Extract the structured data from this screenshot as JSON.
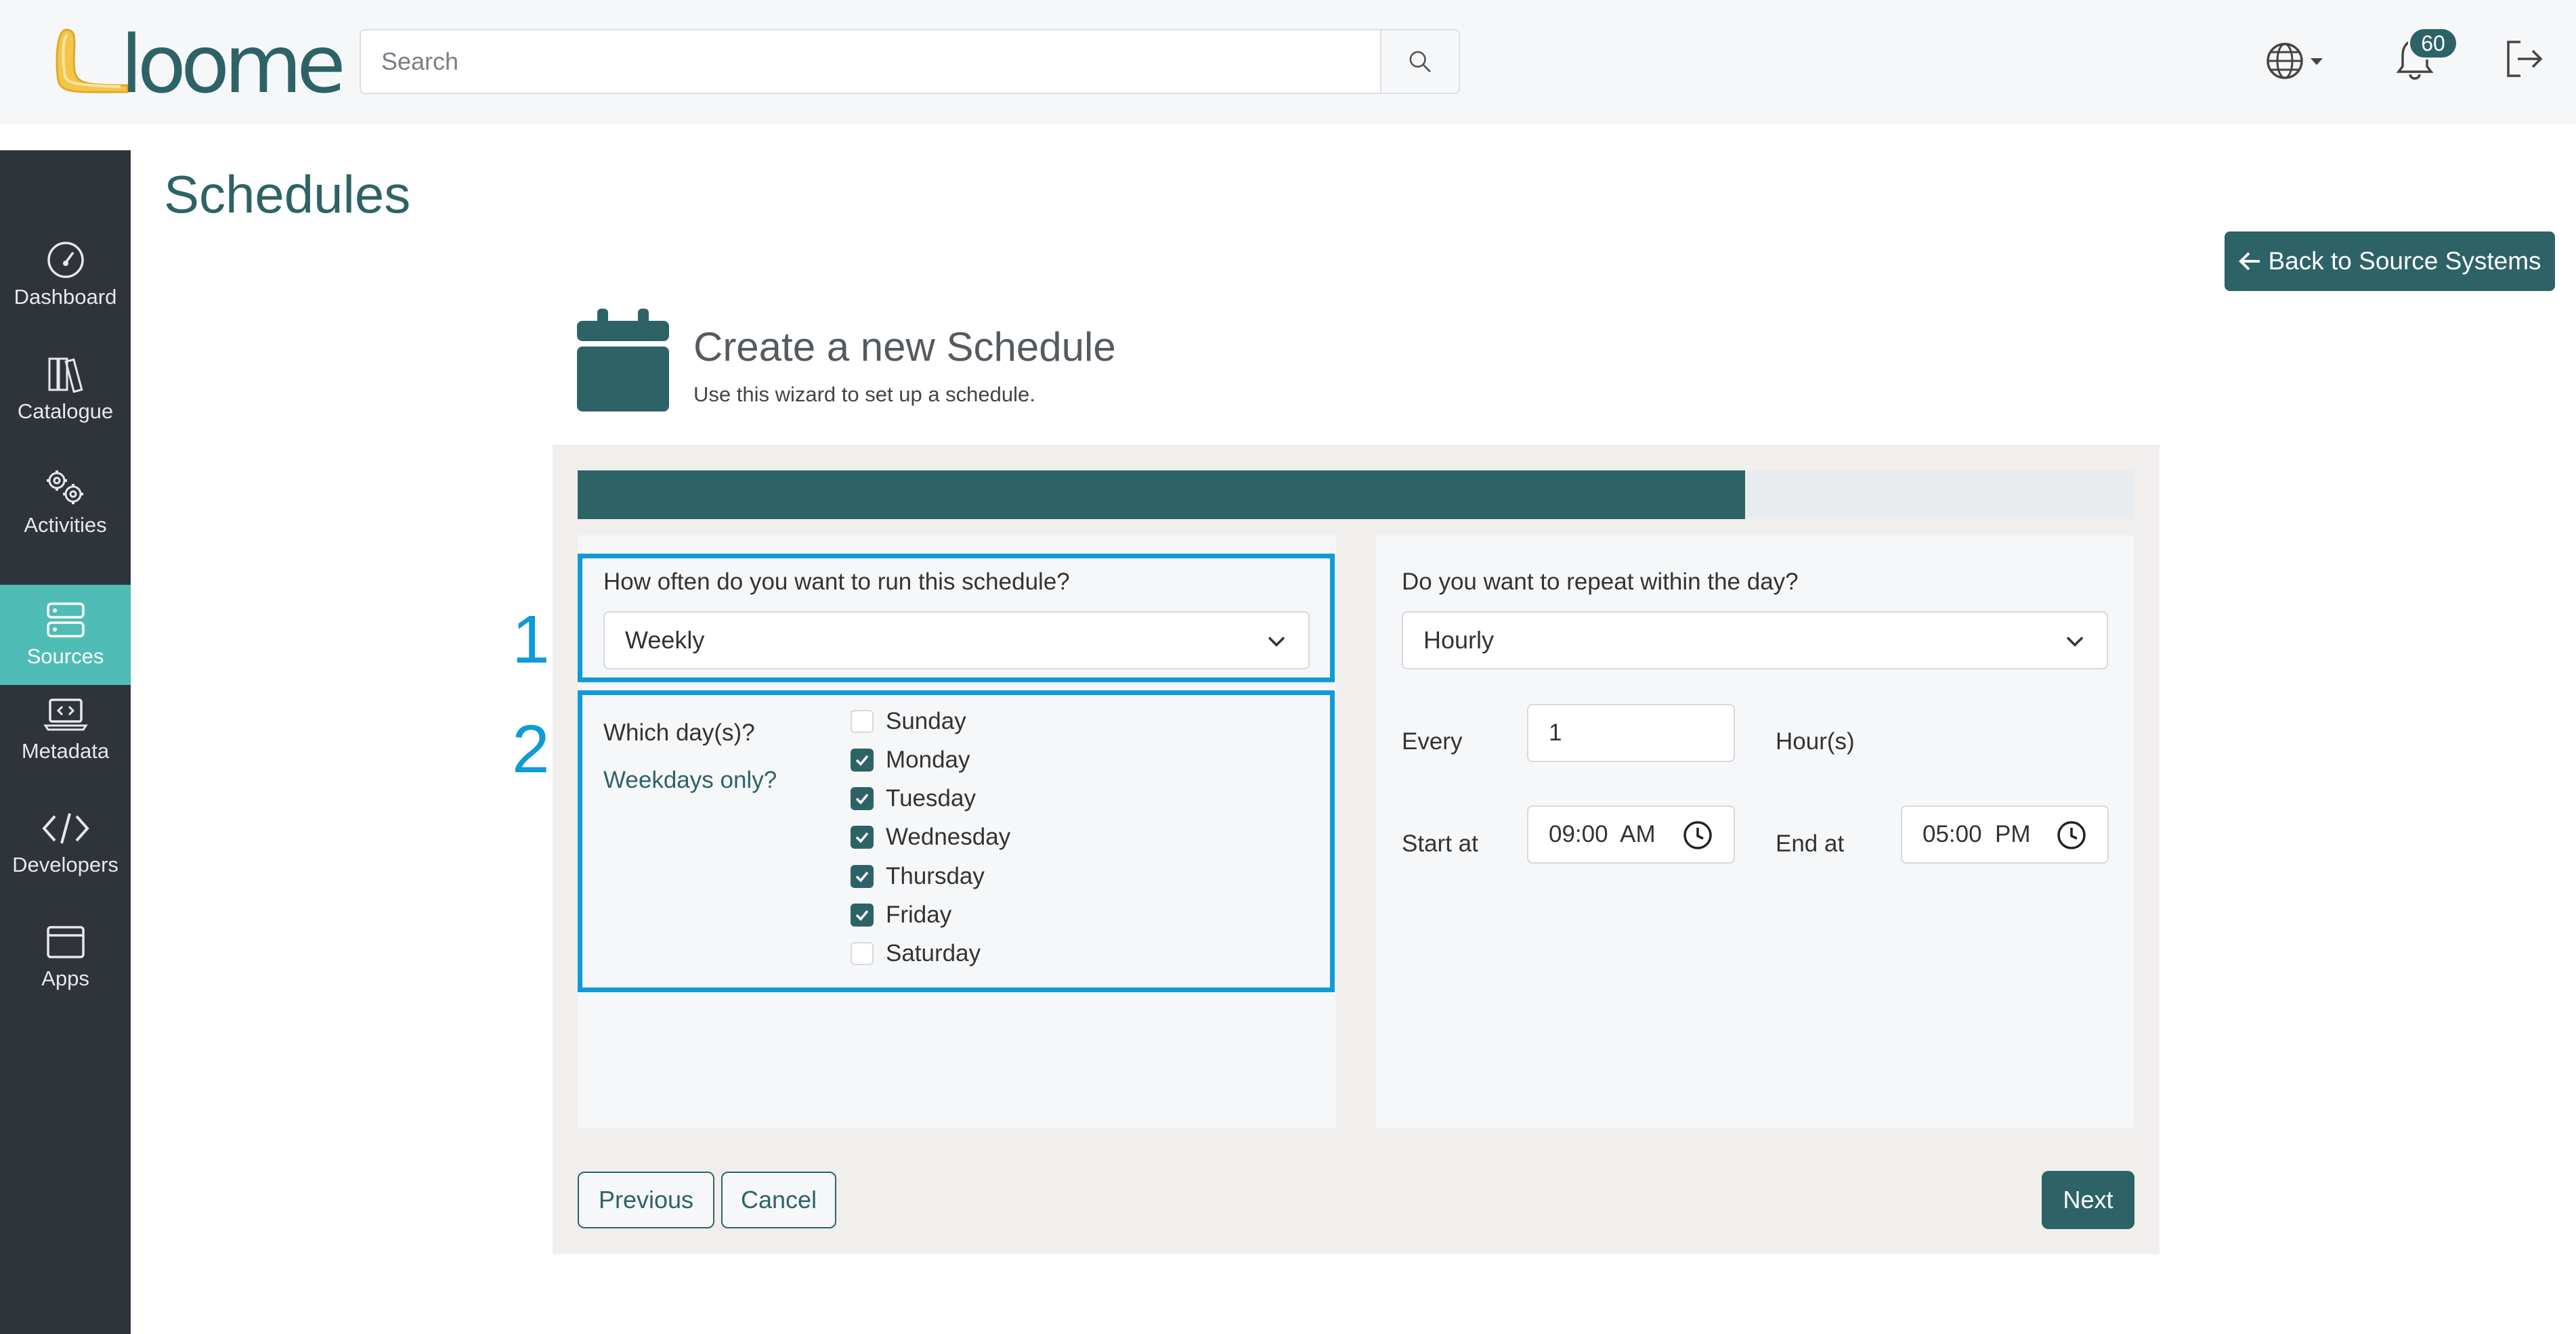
{
  "app": {
    "logo_text": "loome"
  },
  "header": {
    "search_placeholder": "Search",
    "notification_count": "60",
    "icons": [
      "search-icon",
      "globe-icon",
      "bell-icon",
      "logout-icon"
    ]
  },
  "sidebar": {
    "items": [
      {
        "label": "Dashboard",
        "icon": "gauge-icon",
        "active": false
      },
      {
        "label": "Catalogue",
        "icon": "books-icon",
        "active": false
      },
      {
        "label": "Activities",
        "icon": "gears-icon",
        "active": false
      },
      {
        "label": "Sources",
        "icon": "server-icon",
        "active": true
      },
      {
        "label": "Metadata",
        "icon": "laptop-code-icon",
        "active": false
      },
      {
        "label": "Developers",
        "icon": "code-icon",
        "active": false
      },
      {
        "label": "Apps",
        "icon": "window-icon",
        "active": false
      }
    ]
  },
  "page": {
    "title": "Schedules",
    "back_label": "Back to Source Systems"
  },
  "wizard": {
    "title": "Create a new Schedule",
    "subtitle": "Use this wizard to set up a schedule.",
    "progress": 0.75,
    "annotations": [
      "1",
      "2"
    ],
    "frequency": {
      "question": "How often do you want to run this schedule?",
      "value": "Weekly"
    },
    "days": {
      "question": "Which day(s)?",
      "weekdays_link": "Weekdays only?",
      "options": [
        {
          "label": "Sunday",
          "checked": false
        },
        {
          "label": "Monday",
          "checked": true
        },
        {
          "label": "Tuesday",
          "checked": true
        },
        {
          "label": "Wednesday",
          "checked": true
        },
        {
          "label": "Thursday",
          "checked": true
        },
        {
          "label": "Friday",
          "checked": true
        },
        {
          "label": "Saturday",
          "checked": false
        }
      ]
    },
    "repeat": {
      "question": "Do you want to repeat within the day?",
      "value": "Hourly",
      "every_label": "Every",
      "every_value": "1",
      "unit_label": "Hour(s)",
      "start_label": "Start at",
      "start_value": "09:00  AM",
      "end_label": "End at",
      "end_value": "05:00  PM"
    },
    "buttons": {
      "previous": "Previous",
      "cancel": "Cancel",
      "next": "Next"
    }
  },
  "colors": {
    "primary": "#2d6366",
    "accent": "#4fbdb5",
    "highlight": "#0f9bd7",
    "sidebar_bg": "#2f343b"
  }
}
